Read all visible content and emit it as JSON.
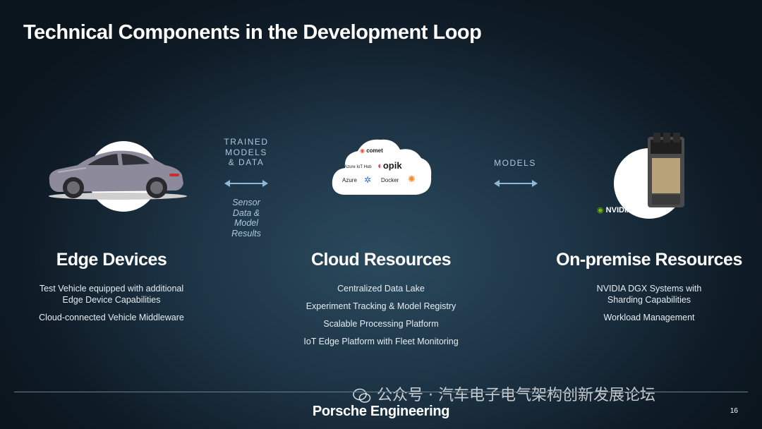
{
  "title": "Technical Components in the Development Loop",
  "left_arrow": {
    "top_label": [
      "TRAINED",
      "MODELS",
      "& DATA"
    ],
    "bottom_label": [
      "Sensor",
      "Data &",
      "Model",
      "Results"
    ]
  },
  "right_arrow": {
    "top_label": "MODELS"
  },
  "cloud": {
    "comet": "comet",
    "iot_hub": "Azure IoT Hub",
    "opik": "opik",
    "azure": "Azure",
    "docker": "Docker"
  },
  "nvidia_logo": "NVIDIA",
  "columns": [
    {
      "heading": "Edge Devices",
      "lines": [
        "Test Vehicle equipped with additional Edge Device Capabilities",
        "Cloud-connected Vehicle Middleware"
      ]
    },
    {
      "heading": "Cloud Resources",
      "lines": [
        "Centralized Data Lake",
        "Experiment Tracking & Model Registry",
        "Scalable Processing Platform",
        "IoT Edge Platform with Fleet Monitoring"
      ]
    },
    {
      "heading": "On-premise Resources",
      "lines": [
        "NVIDIA DGX Systems with Sharding Capabilities",
        "Workload Management"
      ]
    }
  ],
  "footer": {
    "brand": "Porsche Engineering",
    "page_number": "16",
    "watermark": "公众号 · 汽车电子电气架构创新发展论坛"
  },
  "colors": {
    "background": "#1d3445",
    "arrow": "#8fb8d8",
    "label": "#a9c8e0"
  }
}
